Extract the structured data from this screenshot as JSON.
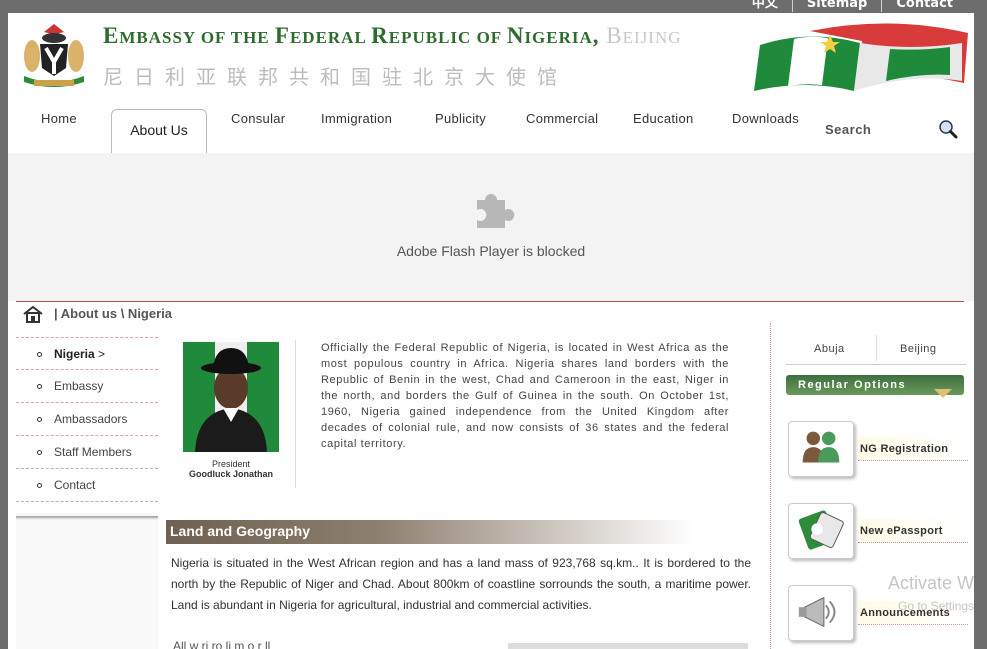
{
  "top_links": [
    "中文",
    "Sitemap",
    "Contact"
  ],
  "header": {
    "title_parts": [
      "E",
      "MBASSY ",
      "OF THE ",
      "F",
      "EDERAL ",
      "R",
      "EPUBLIC ",
      "OF ",
      "N",
      "IGERIA",
      ", ",
      "B",
      "EIJING"
    ],
    "title_cn": "尼日利亚联邦共和国驻北京大使馆"
  },
  "nav": {
    "items": [
      "Home",
      "About Us",
      "Consular",
      "Immigration",
      "Publicity",
      "Commercial",
      "Education",
      "Downloads"
    ],
    "active": "About Us",
    "search_label": "Search"
  },
  "flash": {
    "message": "Adobe Flash Player is blocked"
  },
  "breadcrumb": {
    "text": "| About us \\ Nigeria"
  },
  "sidebar": {
    "items": [
      {
        "label": "Nigeria",
        "suffix": ">",
        "active": true
      },
      {
        "label": "Embassy"
      },
      {
        "label": "Ambassadors"
      },
      {
        "label": "Staff Members"
      },
      {
        "label": "Contact"
      }
    ]
  },
  "president": {
    "caption_title": "President",
    "caption_name": "Goodluck Jonathan"
  },
  "intro_text": "Officially the Federal Republic of Nigeria, is located in West Africa as the most populous country in Africa. Nigeria shares land borders with the Republic of Benin in the west, Chad and Cameroon in the east, Niger in the north, and borders the Gulf of Guinea in the south. On October 1st, 1960, Nigeria gained independence from the United Kingdom after decades of colonial rule, and now consists of 36 states and the federal capital territory.",
  "section": {
    "title": "Land and Geography",
    "body": "Nigeria is situated in the West African region and has a land mass of 923,768 sq.km.. It is bordered to the north by the Republic of Niger and Chad. About 800km of coastline sorrounds the south, a maritime power. Land is abundant in Nigeria for agricultural, industrial and commercial activities.",
    "next_line_partial": "All w ri     ro   li    m o              r    ll"
  },
  "right_panel": {
    "cities": [
      "Abuja",
      "Beijing"
    ],
    "regular_options": "Regular Options",
    "options": [
      {
        "label": "NG Registration",
        "icon": "users-icon"
      },
      {
        "label": "New ePassport",
        "icon": "passport-icon"
      },
      {
        "label": "Announcements",
        "icon": "megaphone-icon"
      }
    ]
  },
  "overlay": {
    "watermark": "Activate Wi",
    "watermark_sub": "Go to Settings"
  },
  "colors": {
    "accent_green": "#2e6b2e",
    "divider_red": "#b05050",
    "section_brown": "#6e6151"
  }
}
